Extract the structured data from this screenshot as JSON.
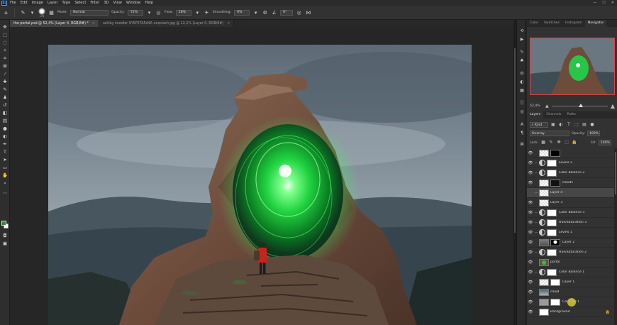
{
  "menu": {
    "logo": "Ps",
    "items": [
      "File",
      "Edit",
      "Image",
      "Layer",
      "Type",
      "Select",
      "Filter",
      "3D",
      "View",
      "Window",
      "Help"
    ],
    "window_controls": [
      "—",
      "☐",
      "✕"
    ]
  },
  "options": {
    "brush_size": "175",
    "mode_label": "Mode:",
    "mode_value": "Normal",
    "opacity_label": "Opacity:",
    "opacity_value": "72%",
    "flow_label": "Flow:",
    "flow_value": "28%",
    "smoothing_label": "Smoothing:",
    "smoothing_value": "0%",
    "angle_value": "0°"
  },
  "tabs": [
    {
      "label": "the portal.psd @ 52,4% (Layer 4, RGB/8#) *",
      "close": "×"
    },
    {
      "label": "ashley knedler 9Y5P5TA5d4A unsplash.jpg @ 22,2% (Layer 0, RGB/8#)",
      "close": "×"
    }
  ],
  "panel_tabs_top": [
    "Color",
    "Swatches",
    "Histogram",
    "Navigator"
  ],
  "navigator": {
    "zoom": "52,4%",
    "zoom_level": 0.48
  },
  "panel_tabs_layers": [
    "Layers",
    "Channels",
    "Paths"
  ],
  "layers_panel": {
    "kind_filter": "Kind",
    "blend_mode": "Overlay",
    "opacity_label": "Opacity:",
    "opacity_value": "100%",
    "lock_label": "Lock:",
    "fill_label": "Fill:",
    "fill_value": "100%",
    "layers": [
      {
        "name": "",
        "type": "pixel",
        "visible": true
      },
      {
        "name": "Levels 2",
        "type": "adjustment",
        "visible": true
      },
      {
        "name": "Color Balance 2",
        "type": "adjustment",
        "visible": true
      },
      {
        "name": "clouds",
        "type": "pixel",
        "visible": true
      },
      {
        "name": "Layer 4",
        "type": "pixel",
        "visible": false,
        "selected": true
      },
      {
        "name": "Layer 3",
        "type": "pixel",
        "visible": true
      },
      {
        "name": "Color Balance 3",
        "type": "adjustment",
        "visible": true
      },
      {
        "name": "Hue/Saturation 3",
        "type": "adjustment",
        "visible": true
      },
      {
        "name": "Levels 1",
        "type": "adjustment",
        "visible": true
      },
      {
        "name": "Layer 2",
        "type": "pixel",
        "visible": true
      },
      {
        "name": "Hue/Saturation 2",
        "type": "adjustment",
        "visible": true
      },
      {
        "name": "portal",
        "type": "pixel",
        "visible": true
      },
      {
        "name": "Color Balance 1",
        "type": "adjustment",
        "visible": true
      },
      {
        "name": "Layer 1",
        "type": "pixel",
        "visible": true
      },
      {
        "name": "cloud",
        "type": "pixel",
        "visible": true
      },
      {
        "name": "Color Fill 1",
        "type": "fill",
        "visible": true
      },
      {
        "name": "Background",
        "type": "background",
        "visible": true,
        "locked": true
      }
    ]
  },
  "colors": {
    "accent": "#31a8ff",
    "foreground": "#2d8f2d",
    "background": "#ffffff",
    "portal_glow": "#39ff5a"
  }
}
